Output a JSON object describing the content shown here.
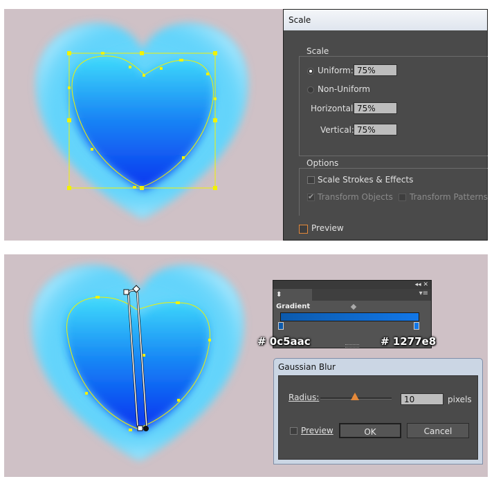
{
  "scale_dialog": {
    "title": "Scale",
    "scale_group": "Scale",
    "uniform_label": "Uniform:",
    "uniform_value": "75%",
    "non_uniform_label": "Non-Uniform",
    "horizontal_label": "Horizontal:",
    "horizontal_value": "75%",
    "vertical_label": "Vertical:",
    "vertical_value": "75%",
    "options_group": "Options",
    "scale_strokes_label": "Scale Strokes & Effects",
    "transform_objects_label": "Transform Objects",
    "transform_patterns_label": "Transform Patterns",
    "preview_label": "Preview"
  },
  "gradient_panel": {
    "tab_label": "Gradient",
    "start_color": "#0c5aac",
    "end_color": "#1277e8",
    "start_label": "# 0c5aac",
    "end_label": "# 1277e8",
    "panel_controls": "◂◂ ✕"
  },
  "gaussian_blur": {
    "title": "Gaussian Blur",
    "radius_label": "Radius:",
    "radius_value": "10",
    "radius_unit": "pixels",
    "preview_label": "Preview",
    "ok_label": "OK",
    "cancel_label": "Cancel"
  },
  "colors": {
    "canvas_bg": "#cfc1c6",
    "heart_light": "#5fe8fb",
    "heart_dark": "#0a2ff0",
    "selection_yellow": "#f2f200"
  }
}
